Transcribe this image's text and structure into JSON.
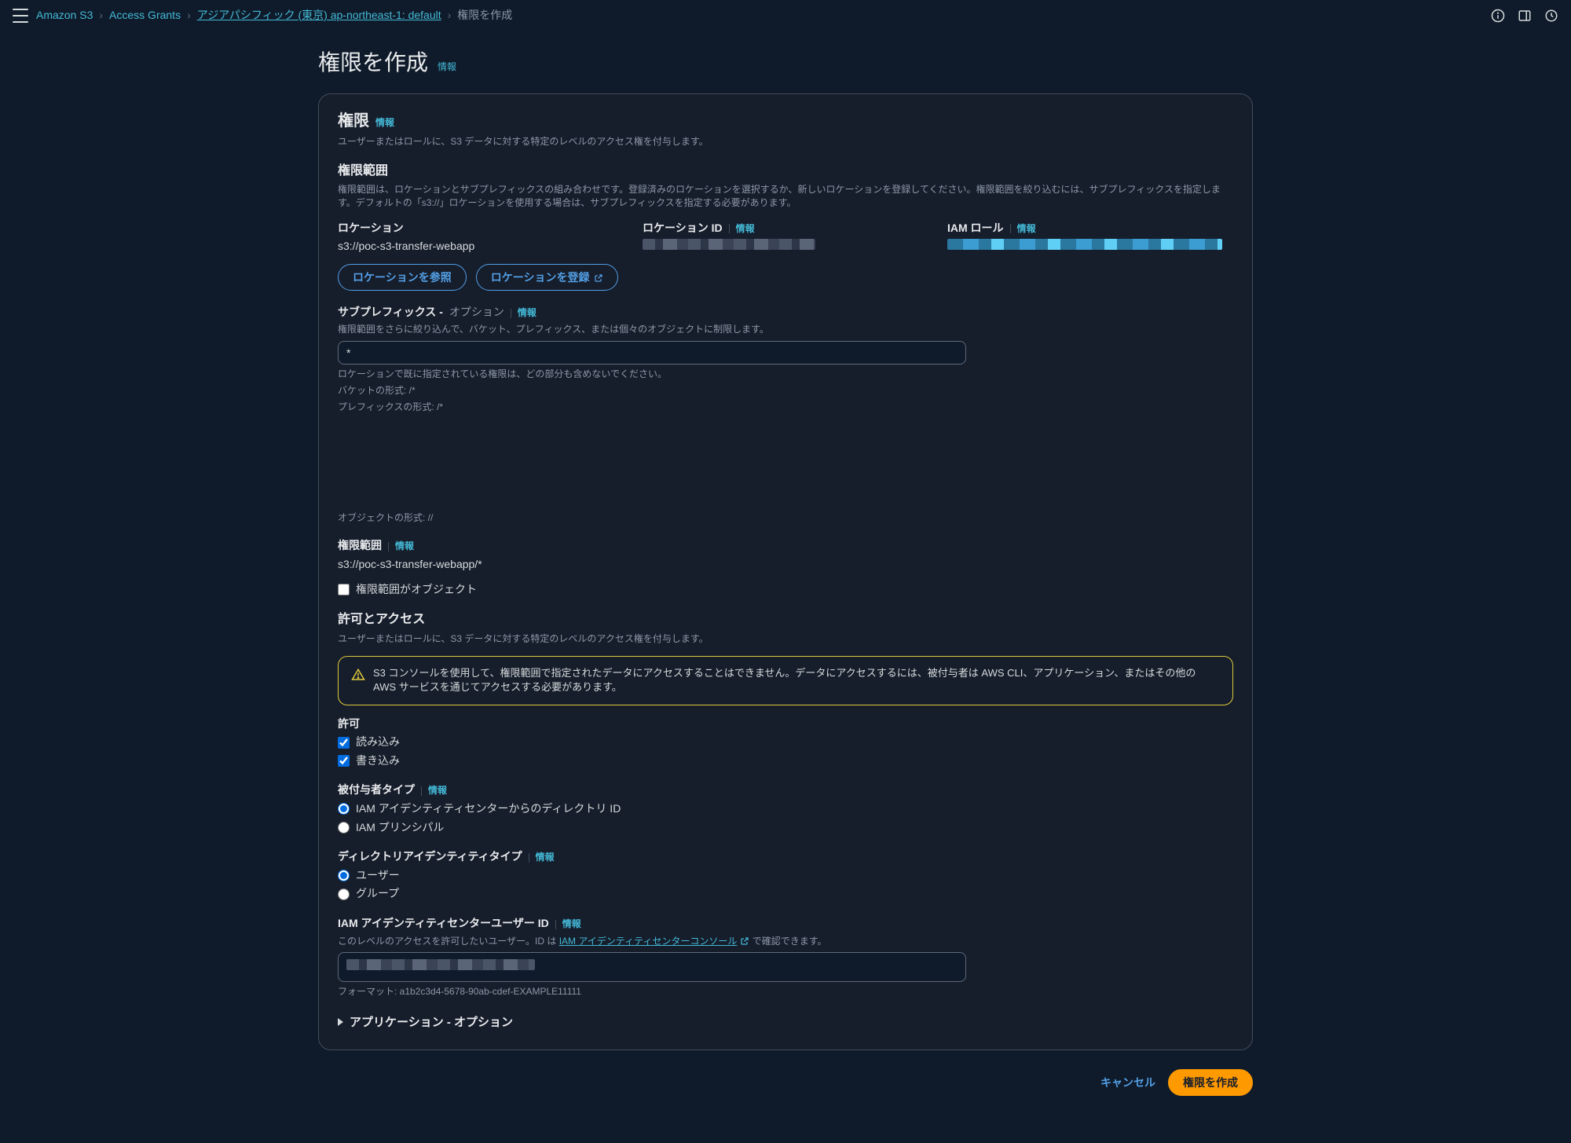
{
  "breadcrumb": {
    "items": [
      "Amazon S3",
      "Access Grants",
      "アジアパシフィック (東京) ap-northeast-1: default",
      "権限を作成"
    ]
  },
  "page": {
    "title": "権限を作成",
    "info": "情報"
  },
  "permissionsPanel": {
    "title": "権限",
    "info": "情報",
    "desc": "ユーザーまたはロールに、S3 データに対する特定のレベルのアクセス権を付与します。",
    "scopeTitle": "権限範囲",
    "scopeDesc": "権限範囲は、ロケーションとサブプレフィックスの組み合わせです。登録済みのロケーションを選択するか、新しいロケーションを登録してください。権限範囲を絞り込むには、サブプレフィックスを指定します。デフォルトの「s3://」ロケーションを使用する場合は、サブプレフィックスを指定する必要があります。",
    "locationLabel": "ロケーション",
    "locationValue": "s3://poc-s3-transfer-webapp",
    "locationIdLabel": "ロケーション ID",
    "locationIdInfo": "情報",
    "iamRoleLabel": "IAM ロール",
    "iamRoleInfo": "情報",
    "browseBtn": "ロケーションを参照",
    "registerBtn": "ロケーションを登録",
    "subprefixLabel": "サブプレフィックス - ",
    "subprefixOptional": "オプション",
    "subprefixInfo": "情報",
    "subprefixDesc": "権限範囲をさらに絞り込んで、バケット、プレフィックス、または個々のオブジェクトに制限します。",
    "subprefixValue": "*",
    "subprefixHint1": "ロケーションで既に指定されている権限は、どの部分も含めないでください。",
    "subprefixHint2": "バケットの形式: /*",
    "subprefixHint3": "プレフィックスの形式: /*",
    "objectFormat": "オブジェクトの形式: //",
    "scopeLabel2": "権限範囲",
    "scopeInfo2": "情報",
    "scopeValue2": "s3://poc-s3-transfer-webapp/*",
    "scopeIsObjectLabel": "権限範囲がオブジェクト",
    "accessTitle": "許可とアクセス",
    "accessDesc": "ユーザーまたはロールに、S3 データに対する特定のレベルのアクセス権を付与します。",
    "alert": "S3 コンソールを使用して、権限範囲で指定されたデータにアクセスすることはできません。データにアクセスするには、被付与者は AWS CLI、アプリケーション、またはその他の AWS サービスを通じてアクセスする必要があります。",
    "permitLabel": "許可",
    "readLabel": "読み込み",
    "writeLabel": "書き込み",
    "granteeTypeLabel": "被付与者タイプ",
    "granteeTypeInfo": "情報",
    "granteeOption1": "IAM アイデンティティセンターからのディレクトリ ID",
    "granteeOption2": "IAM プリンシパル",
    "dirIdentityTypeLabel": "ディレクトリアイデンティティタイプ",
    "dirIdentityTypeInfo": "情報",
    "dirOption1": "ユーザー",
    "dirOption2": "グループ",
    "iamUserIdLabel": "IAM アイデンティティセンターユーザー ID",
    "iamUserIdInfo": "情報",
    "iamUserIdDesc1": "このレベルのアクセスを許可したいユーザー。ID は ",
    "iamUserIdLink": "IAM アイデンティティセンターコンソール",
    "iamUserIdDesc2": "で確認できます。",
    "iamUserIdFormat": "フォーマット: a1b2c3d4-5678-90ab-cdef-EXAMPLE11111",
    "applicationSection": "アプリケーション - オプション"
  },
  "footer": {
    "cancel": "キャンセル",
    "create": "権限を作成"
  }
}
